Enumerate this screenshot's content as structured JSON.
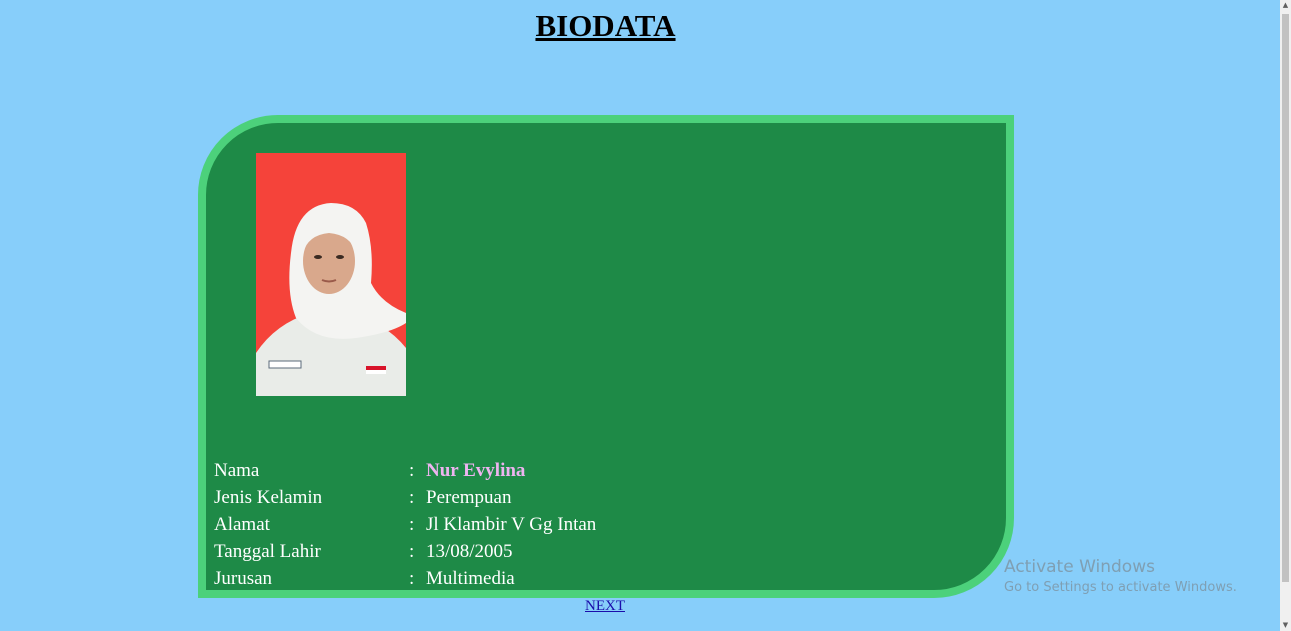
{
  "page": {
    "title": "BIODATA"
  },
  "biodata": {
    "rows": [
      {
        "label": "Nama",
        "sep": ":",
        "value": "Nur Evylina"
      },
      {
        "label": "Jenis Kelamin",
        "sep": ":",
        "value": "Perempuan"
      },
      {
        "label": "Alamat",
        "sep": ":",
        "value": "Jl Klambir V Gg Intan"
      },
      {
        "label": "Tanggal Lahir",
        "sep": ":",
        "value": "13/08/2005"
      },
      {
        "label": "Jurusan",
        "sep": ":",
        "value": "Multimedia"
      }
    ]
  },
  "nav": {
    "next_label": "NEXT"
  },
  "watermark": {
    "title": "Activate Windows",
    "subtitle": "Go to Settings to activate Windows."
  },
  "colors": {
    "page_bg": "#87cefa",
    "card_bg": "#1e8a47",
    "card_border": "#4cd17b",
    "photo_bg": "#f5433a",
    "name_highlight": "#eeb4f0"
  }
}
